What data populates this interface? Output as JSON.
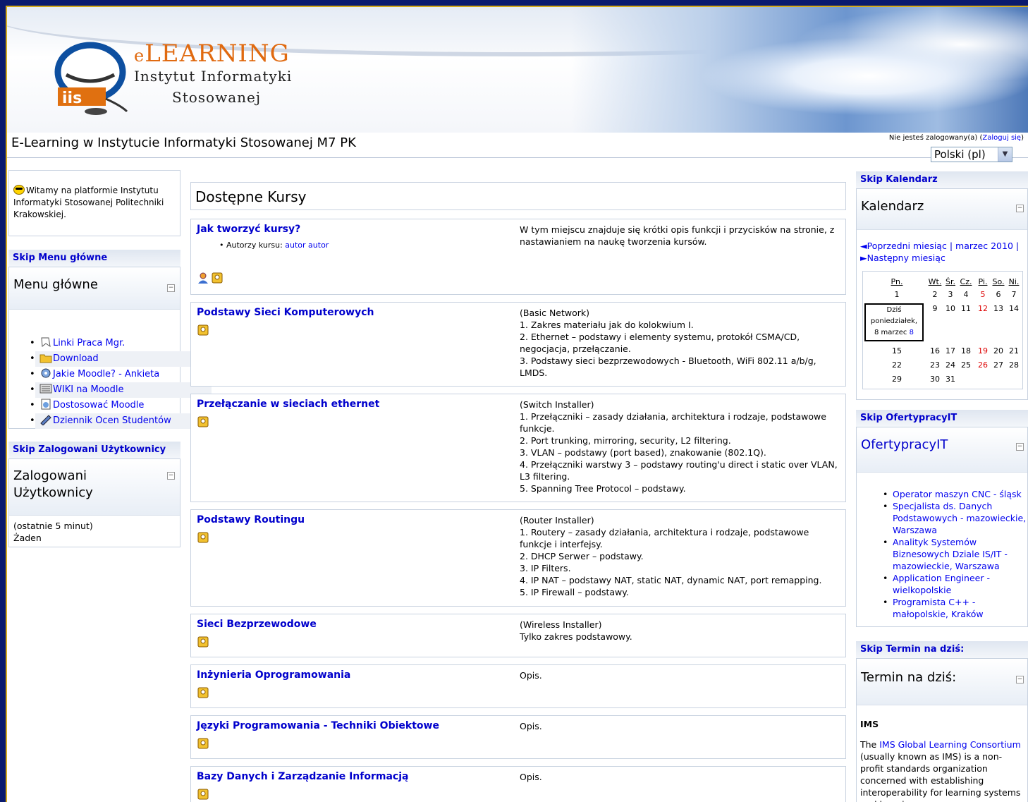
{
  "header": {
    "logo_line1_prefix": "e",
    "logo_line1_rest": "LEARNING",
    "logo_line2": "Instytut Informatyki",
    "logo_line3": "Stosowanej",
    "site_title": "E-Learning w Instytucie Informatyki Stosowanej M7 PK",
    "login_status": "Nie jesteś zalogowany(a)",
    "login_link": "Zaloguj się",
    "language": "Polski (pl)"
  },
  "left": {
    "welcome": "Witamy na platformie Instytutu Informatyki Stosowanej Politechniki Krakowskiej.",
    "menu_skip": "Skip Menu główne",
    "menu_title": "Menu główne",
    "menu_items": [
      {
        "label": "Linki Praca Mgr.",
        "icon": "bookmark-icon"
      },
      {
        "label": "Download",
        "icon": "folder-icon"
      },
      {
        "label": "Jakie Moodle? - Ankieta",
        "icon": "survey-icon"
      },
      {
        "label": "WIKI na Moodle",
        "icon": "wiki-icon"
      },
      {
        "label": "Dostosować Moodle",
        "icon": "page-icon"
      },
      {
        "label": "Dziennik Ocen Studentów",
        "icon": "pen-icon"
      }
    ],
    "users_skip": "Skip Zalogowani Użytkownicy",
    "users_title_1": "Zalogowani",
    "users_title_2": "Użytkownicy",
    "users_period": "(ostatnie 5 minut)",
    "users_none": "Żaden"
  },
  "main": {
    "title": "Dostępne Kursy",
    "courses": [
      {
        "name": "Jak tworzyć kursy?",
        "teachers_label": "Autorzy kursu:",
        "teacher": "autor autor",
        "desc": "W tym miejscu znajduje się krótki opis funkcji i przycisków na stronie, z nastawianiem na naukę tworzenia kursów."
      },
      {
        "name": "Podstawy Sieci Komputerowych",
        "desc": "(Basic Network)\n1. Zakres materiału jak do kolokwium I.\n2. Ethernet – podstawy i elementy systemu, protokół CSMA/CD, negocjacja, przełączanie.\n3. Podstawy sieci bezprzewodowych - Bluetooth, WiFi 802.11 a/b/g, LMDS."
      },
      {
        "name": "Przełączanie w sieciach ethernet",
        "desc": "(Switch Installer)\n1. Przełączniki – zasady działania, architektura i rodzaje, podstawowe funkcje.\n2. Port trunking, mirroring, security, L2 filtering.\n3. VLAN – podstawy (port based), znakowanie (802.1Q).\n4. Przełączniki warstwy 3 – podstawy routing'u direct i static over VLAN, L3 filtering.\n5. Spanning Tree Protocol – podstawy."
      },
      {
        "name": "Podstawy Routingu",
        "desc": "(Router Installer)\n1. Routery – zasady działania, architektura i rodzaje, podstawowe funkcje i interfejsy.\n2. DHCP Serwer – podstawy.\n3. IP Filters.\n4. IP NAT – podstawy NAT, static NAT, dynamic NAT, port remapping.\n5. IP Firewall – podstawy."
      },
      {
        "name": "Sieci Bezprzewodowe",
        "desc": "(Wireless Installer)\nTylko zakres podstawowy."
      },
      {
        "name": "Inżynieria Oprogramowania",
        "desc": "Opis."
      },
      {
        "name": "Języki Programowania - Techniki Obiektowe",
        "desc": "Opis."
      },
      {
        "name": "Bazy Danych i Zarządzanie Informacją",
        "desc": "Opis."
      }
    ]
  },
  "right": {
    "cal_skip": "Skip Kalendarz",
    "cal_title": "Kalendarz",
    "cal_prev": "◄Poprzedni miesiąc",
    "cal_month": "marzec 2010",
    "cal_next": "►Następny miesiąc",
    "cal_days": [
      "Pn.",
      "Wt.",
      "Śr.",
      "Cz.",
      "Pi.",
      "So.",
      "Ni."
    ],
    "cal_today_1": "Dziś",
    "cal_today_2": "poniedziałek,",
    "cal_today_3": "8 marzec",
    "cal_today_num": "8",
    "cal_weeks": [
      [
        "1",
        "2",
        "3",
        "4",
        "5",
        "6",
        "7"
      ],
      [
        "",
        "9",
        "10",
        "11",
        "12",
        "13",
        "14"
      ],
      [
        "15",
        "16",
        "17",
        "18",
        "19",
        "20",
        "21"
      ],
      [
        "22",
        "23",
        "24",
        "25",
        "26",
        "27",
        "28"
      ],
      [
        "29",
        "30",
        "31",
        "",
        "",
        "",
        ""
      ]
    ],
    "jobs_skip": "Skip OfertypracyIT",
    "jobs_title": "OfertypracyIT",
    "jobs": [
      "Operator maszyn CNC - śląsk",
      "Specjalista ds. Danych Podstawowych - mazowieckie, Warszawa",
      "Analityk Systemów Biznesowych Dziale IS/IT - mazowieckie, Warszawa",
      "Application Engineer - wielkopolskie",
      "Programista C++ - małopolskie, Kraków"
    ],
    "term_skip": "Skip Termin na dziś:",
    "term_title": "Termin na dziś:",
    "term_word": "IMS",
    "term_intro": "The",
    "term_link": "IMS Global Learning Consortium",
    "term_rest": "(usually known as IMS) is a non-profit standards organization concerned with establishing interoperability for learning systems and learning"
  },
  "colors": {
    "accent_link": "#0000cc",
    "weekend_red": "#dd0000",
    "frame_bg": "#0a1a6e"
  }
}
